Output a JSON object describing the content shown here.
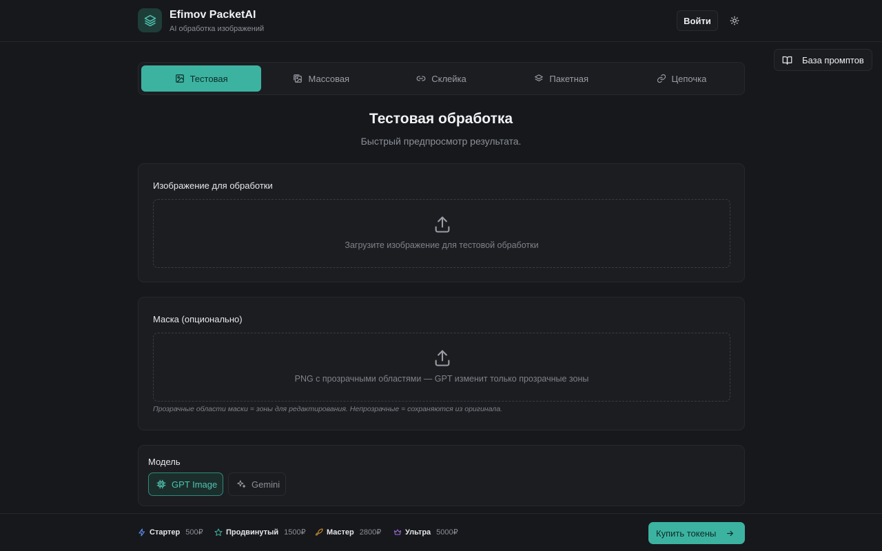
{
  "header": {
    "app_name": "Efimov PacketAI",
    "app_subtitle": "AI обработка изображений",
    "login_label": "Войти",
    "logo_icon": "layers-icon",
    "theme_icon": "sun-icon"
  },
  "prompt_base": {
    "label": "База промптов",
    "icon": "book-icon"
  },
  "tabs": [
    {
      "label": "Тестовая",
      "icon": "image-icon",
      "active": true
    },
    {
      "label": "Массовая",
      "icon": "images-icon",
      "active": false
    },
    {
      "label": "Склейка",
      "icon": "link-icon",
      "active": false
    },
    {
      "label": "Пакетная",
      "icon": "layers-icon",
      "active": false
    },
    {
      "label": "Цепочка",
      "icon": "chain-icon",
      "active": false
    }
  ],
  "page": {
    "title": "Тестовая обработка",
    "subtitle": "Быстрый предпросмотр результата."
  },
  "image_card": {
    "label": "Изображение для обработки",
    "dropzone_text": "Загрузите изображение для тестовой обработки",
    "icon": "upload-icon"
  },
  "mask_card": {
    "label": "Маска (опционально)",
    "dropzone_text": "PNG с прозрачными областями — GPT изменит только прозрачные зоны",
    "hint": "Прозрачные области маски = зоны для редактирования. Непрозрачные = сохраняются из оригинала.",
    "icon": "upload-icon"
  },
  "model_card": {
    "label": "Модель",
    "options": [
      {
        "label": "GPT Image",
        "icon": "cpu-icon",
        "selected": true
      },
      {
        "label": "Gemini",
        "icon": "sparkles-icon",
        "selected": false
      }
    ]
  },
  "footer": {
    "plans": [
      {
        "name": "Стартер",
        "price": "500₽",
        "icon": "zap-icon",
        "color": "#5b8def"
      },
      {
        "name": "Продвинутый",
        "price": "1500₽",
        "icon": "star-icon",
        "color": "#3cb3a1"
      },
      {
        "name": "Мастер",
        "price": "2800₽",
        "icon": "rocket-icon",
        "color": "#e0a030"
      },
      {
        "name": "Ультра",
        "price": "5000₽",
        "icon": "crown-icon",
        "color": "#a070e0"
      }
    ],
    "buy_label": "Купить токены",
    "buy_icon": "arrow-right-icon"
  },
  "colors": {
    "accent": "#3cb3a1",
    "background": "#17181c",
    "card": "#1c1d21"
  }
}
